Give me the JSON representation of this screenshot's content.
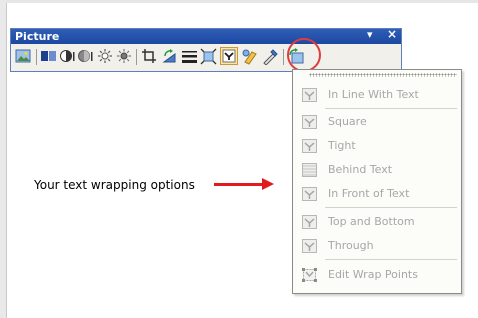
{
  "toolbar": {
    "title": "Picture",
    "controls": {
      "options": "▾",
      "close": "×"
    },
    "tools": [
      "insert-picture-icon",
      "color-icon",
      "more-contrast-icon",
      "less-contrast-icon",
      "more-brightness-icon",
      "less-brightness-icon",
      "crop-icon",
      "rotate-left-icon",
      "line-style-icon",
      "compress-pictures-icon",
      "text-wrapping-icon",
      "format-picture-icon",
      "set-transparent-color-icon",
      "reset-picture-icon"
    ]
  },
  "wrap_menu": {
    "items": [
      {
        "label": "In Line With Text",
        "icon": "inline-wrap-icon"
      },
      {
        "label": "Square",
        "icon": "square-wrap-icon"
      },
      {
        "label": "Tight",
        "icon": "tight-wrap-icon"
      },
      {
        "label": "Behind Text",
        "icon": "behind-text-icon"
      },
      {
        "label": "In Front of Text",
        "icon": "in-front-of-text-icon"
      },
      {
        "label": "Top and Bottom",
        "icon": "top-bottom-wrap-icon"
      },
      {
        "label": "Through",
        "icon": "through-wrap-icon"
      },
      {
        "label": "Edit Wrap Points",
        "icon": "edit-wrap-points-icon"
      }
    ]
  },
  "annotation": {
    "text": "Your text wrapping options",
    "color": "#e21c1c"
  }
}
